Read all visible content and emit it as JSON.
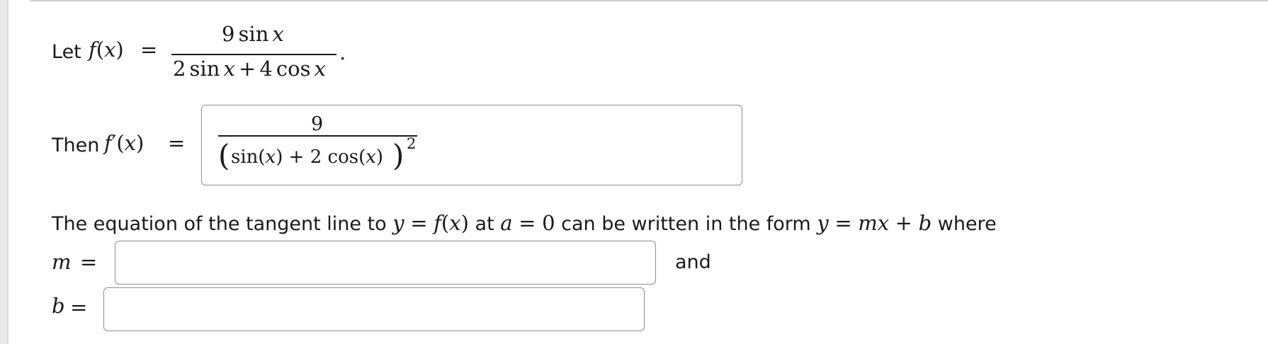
{
  "intro": {
    "let_label": "Let",
    "func": "f",
    "var": "x",
    "equals": "=",
    "numerator_coef": "9",
    "numerator_func": "sin",
    "denominator_coef1": "2",
    "denominator_func1": "sin",
    "plus": "+",
    "denominator_coef2": "4",
    "denominator_func2": "cos",
    "period": "."
  },
  "derivative": {
    "then_label": "Then",
    "func": "f",
    "prime": "′",
    "var": "x",
    "equals": "=",
    "answer": {
      "numerator": "9",
      "sin": "sin",
      "var": "x",
      "plus": "+",
      "coef": "2",
      "cos": "cos",
      "exponent": "2"
    }
  },
  "tangent": {
    "sentence_part1": "The equation of the tangent line to",
    "y_var": "y",
    "equals": "=",
    "func": "f",
    "x_var": "x",
    "at_word": "at",
    "a_var": "a",
    "a_value": "0",
    "sentence_part2": "can be written in the form",
    "form_m": "m",
    "form_b": "b",
    "plus": "+",
    "where_word": "where",
    "m_label": "m",
    "b_label": "b",
    "and_word": "and",
    "m_value": "",
    "b_value": ""
  },
  "colors": {
    "text": "#1a1a1a",
    "input_border": "#8d8d8d",
    "top_rule": "#cfcfd2"
  }
}
